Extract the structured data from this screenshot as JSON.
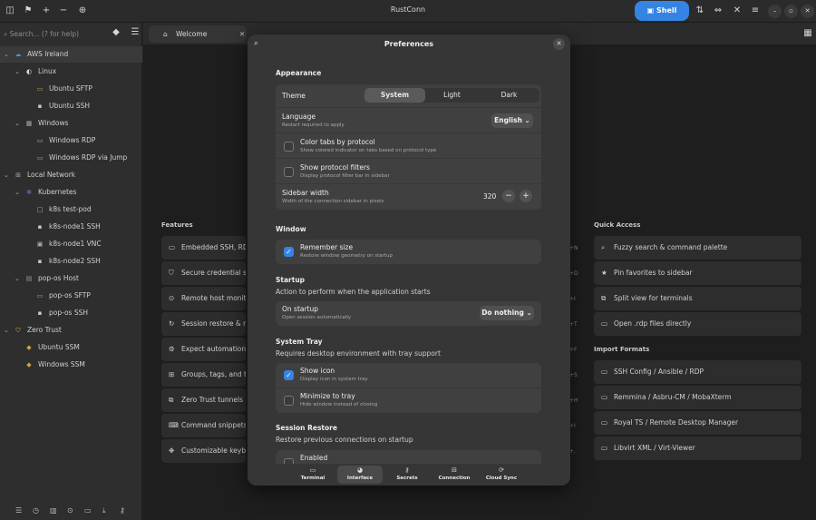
{
  "app": {
    "title": "RustConn",
    "shell_label": "Shell"
  },
  "sidebar": {
    "search_placeholder": "Search... (? for help)",
    "tree": [
      {
        "label": "AWS Ireland",
        "icon": "cloud-icon"
      },
      {
        "label": "Linux",
        "icon": "linux-icon"
      },
      {
        "label": "Ubuntu SFTP",
        "icon": "folder-icon"
      },
      {
        "label": "Ubuntu SSH",
        "icon": "terminal-icon"
      },
      {
        "label": "Windows",
        "icon": "windows-icon"
      },
      {
        "label": "Windows RDP",
        "icon": "monitor-icon"
      },
      {
        "label": "Windows RDP via Jump",
        "icon": "monitor-icon"
      },
      {
        "label": "Local Network",
        "icon": "network-icon"
      },
      {
        "label": "Kubernetes",
        "icon": "kubernetes-icon"
      },
      {
        "label": "k8s test-pod",
        "icon": "pod-icon"
      },
      {
        "label": "k8s-node1 SSH",
        "icon": "terminal-icon"
      },
      {
        "label": "k8s-node1 VNC",
        "icon": "vnc-icon"
      },
      {
        "label": "k8s-node2 SSH",
        "icon": "terminal-icon"
      },
      {
        "label": "pop-os Host",
        "icon": "host-icon"
      },
      {
        "label": "pop-os SFTP",
        "icon": "folder-icon"
      },
      {
        "label": "pop-os SSH",
        "icon": "terminal-icon"
      },
      {
        "label": "Zero Trust",
        "icon": "shield-icon"
      },
      {
        "label": "Ubuntu SSM",
        "icon": "ssm-icon"
      },
      {
        "label": "Windows SSM",
        "icon": "ssm-icon"
      }
    ]
  },
  "tabs": [
    {
      "label": "Welcome"
    }
  ],
  "welcome": {
    "features_title": "Features",
    "features": [
      "Embedded SSH, RDP, V",
      "Secure credential stor",
      "Remote host monitori",
      "Session restore & reco",
      "Expect automation & t",
      "Groups, tags, and tem",
      "Zero Trust tunnels",
      "Command snippets &",
      "Customizable keybind"
    ],
    "shortcuts": [
      "+N",
      "+D",
      "+I",
      "+T",
      "+F",
      "+S",
      "+H",
      "+I",
      "+,"
    ],
    "quick_access_title": "Quick Access",
    "quick_access": [
      "Fuzzy search & command palette",
      "Pin favorites to sidebar",
      "Split view for terminals",
      "Open .rdp files directly"
    ],
    "import_title": "Import Formats",
    "import_formats": [
      "SSH Config / Ansible / RDP",
      "Remmina / Asbru-CM / MobaXterm",
      "Royal TS / Remote Desktop Manager",
      "Libvirt XML / Virt-Viewer"
    ]
  },
  "preferences": {
    "title": "Preferences",
    "appearance": {
      "title": "Appearance",
      "theme_label": "Theme",
      "theme_options": [
        "System",
        "Light",
        "Dark"
      ],
      "theme_selected": "System",
      "language_label": "Language",
      "language_sub": "Restart required to apply",
      "language_value": "English",
      "color_tabs_label": "Color tabs by protocol",
      "color_tabs_sub": "Show colored indicator on tabs based on protocol type",
      "color_tabs_checked": false,
      "protocol_filters_label": "Show protocol filters",
      "protocol_filters_sub": "Display protocol filter bar in sidebar",
      "protocol_filters_checked": false,
      "sidebar_width_label": "Sidebar width",
      "sidebar_width_sub": "Width of the connection sidebar in pixels",
      "sidebar_width_value": "320"
    },
    "window": {
      "title": "Window",
      "remember_label": "Remember size",
      "remember_sub": "Restore window geometry on startup",
      "remember_checked": true
    },
    "startup": {
      "title": "Startup",
      "subtitle": "Action to perform when the application starts",
      "on_startup_label": "On startup",
      "on_startup_sub": "Open session automatically",
      "on_startup_value": "Do nothing"
    },
    "system_tray": {
      "title": "System Tray",
      "subtitle": "Requires desktop environment with tray support",
      "show_icon_label": "Show icon",
      "show_icon_sub": "Display icon in system tray",
      "show_icon_checked": true,
      "minimize_label": "Minimize to tray",
      "minimize_sub": "Hide window instead of closing",
      "minimize_checked": false
    },
    "session_restore": {
      "title": "Session Restore",
      "subtitle": "Restore previous connections on startup",
      "enabled_label": "Enabled"
    },
    "nav": [
      {
        "label": "Terminal",
        "icon": "terminal-icon"
      },
      {
        "label": "Interface",
        "icon": "palette-icon"
      },
      {
        "label": "Secrets",
        "icon": "key-icon"
      },
      {
        "label": "Connection",
        "icon": "network-icon"
      },
      {
        "label": "Cloud Sync",
        "icon": "sync-icon"
      }
    ],
    "nav_selected": "Interface"
  }
}
